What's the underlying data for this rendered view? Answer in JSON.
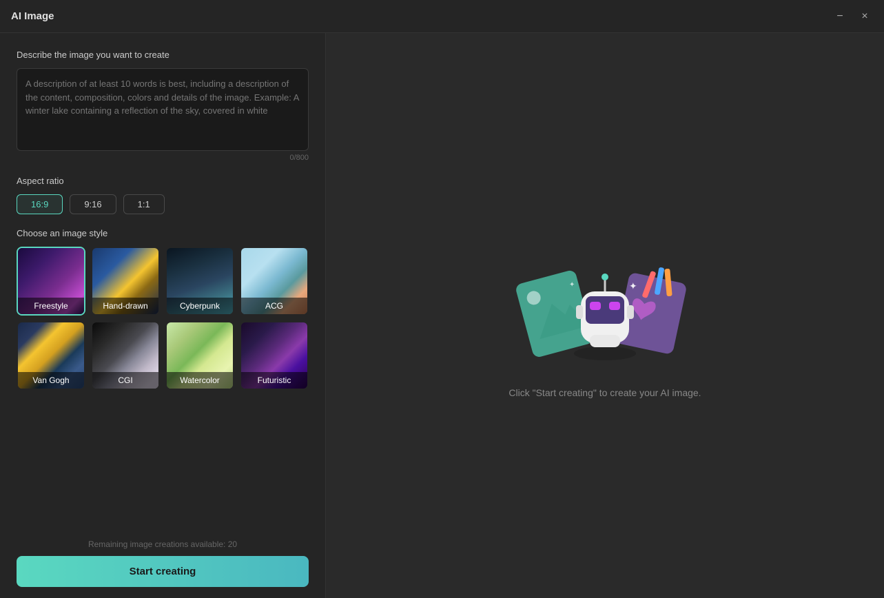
{
  "window": {
    "title": "AI Image",
    "minimize_label": "−",
    "close_label": "×"
  },
  "left": {
    "describe_label": "Describe the image you want to create",
    "textarea_placeholder": "A description of at least 10 words is best, including a description of the content, composition, colors and details of the image. Example: A winter lake containing a reflection of the sky, covered in white",
    "char_count": "0/800",
    "aspect_ratio_label": "Aspect ratio",
    "aspect_options": [
      {
        "label": "16:9",
        "active": true
      },
      {
        "label": "9:16",
        "active": false
      },
      {
        "label": "1:1",
        "active": false
      }
    ],
    "style_label": "Choose an image style",
    "styles": [
      {
        "id": "freestyle",
        "label": "Freestyle",
        "active": true,
        "css_class": "style-freestyle"
      },
      {
        "id": "handdrawn",
        "label": "Hand-drawn",
        "active": false,
        "css_class": "style-handdrawn"
      },
      {
        "id": "cyberpunk",
        "label": "Cyberpunk",
        "active": false,
        "css_class": "style-cyberpunk"
      },
      {
        "id": "acg",
        "label": "ACG",
        "active": false,
        "css_class": "style-acg"
      },
      {
        "id": "vangogh",
        "label": "Van Gogh",
        "active": false,
        "css_class": "style-vangogh"
      },
      {
        "id": "cgi",
        "label": "CGI",
        "active": false,
        "css_class": "style-cgi"
      },
      {
        "id": "watercolor",
        "label": "Watercolor",
        "active": false,
        "css_class": "style-watercolor"
      },
      {
        "id": "futuristic",
        "label": "Futuristic",
        "active": false,
        "css_class": "style-futuristic"
      }
    ],
    "remaining_text": "Remaining image creations available: 20",
    "start_button_label": "Start creating"
  },
  "right": {
    "preview_hint": "Click \"Start creating\" to create your AI image."
  }
}
